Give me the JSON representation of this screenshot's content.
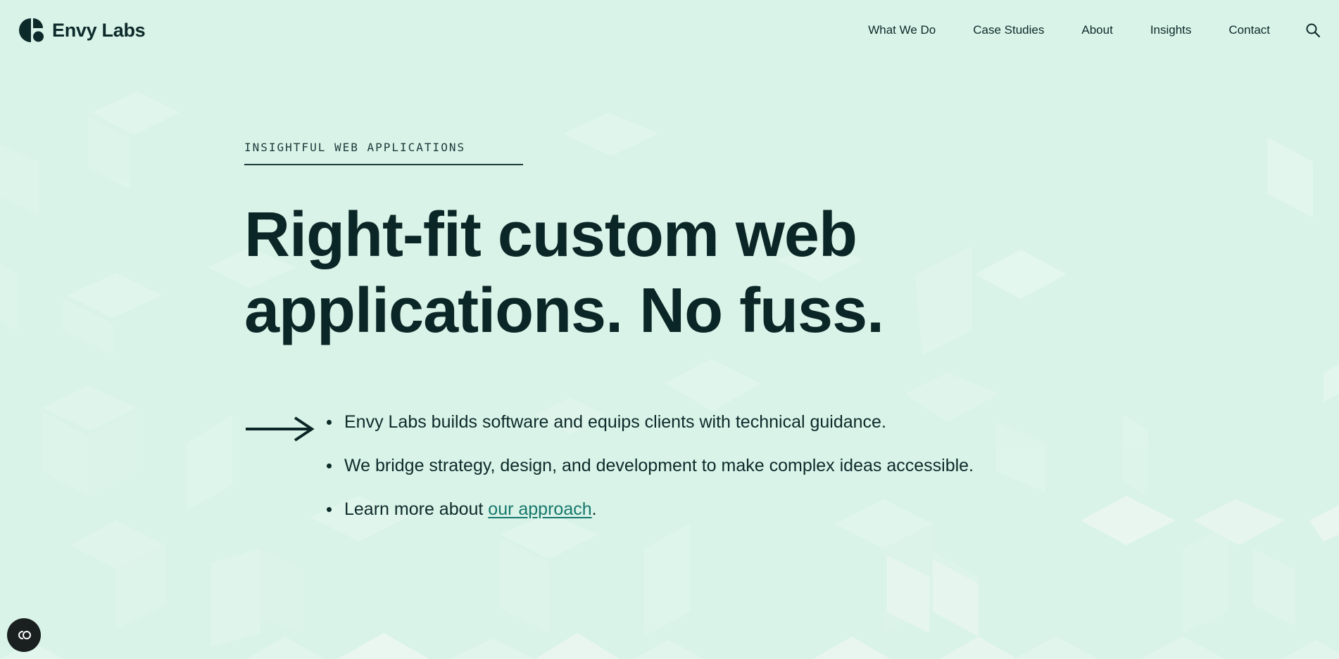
{
  "brand": {
    "name": "Envy Labs"
  },
  "nav": {
    "items": [
      {
        "label": "What We Do"
      },
      {
        "label": "Case Studies"
      },
      {
        "label": "About"
      },
      {
        "label": "Insights"
      },
      {
        "label": "Contact"
      }
    ],
    "search_icon": "search-icon"
  },
  "hero": {
    "eyebrow": "INSIGHTFUL WEB APPLICATIONS",
    "headline_line1": "Right-fit custom web",
    "headline_line2": "applications. No fuss.",
    "arrow_icon": "arrow-right-icon",
    "points": [
      {
        "text": "Envy Labs builds software and equips clients with technical guidance."
      },
      {
        "text": "We bridge strategy, design, and development to make complex ideas accessible."
      },
      {
        "prefix": "Learn more about ",
        "link": "our approach",
        "suffix": "."
      }
    ]
  },
  "cookie_button": {
    "icon": "cookie-preferences-icon"
  },
  "colors": {
    "background": "#d9f3e8",
    "text": "#0d2a2a",
    "link": "#16776b",
    "dark_button": "#1a1f1f"
  }
}
